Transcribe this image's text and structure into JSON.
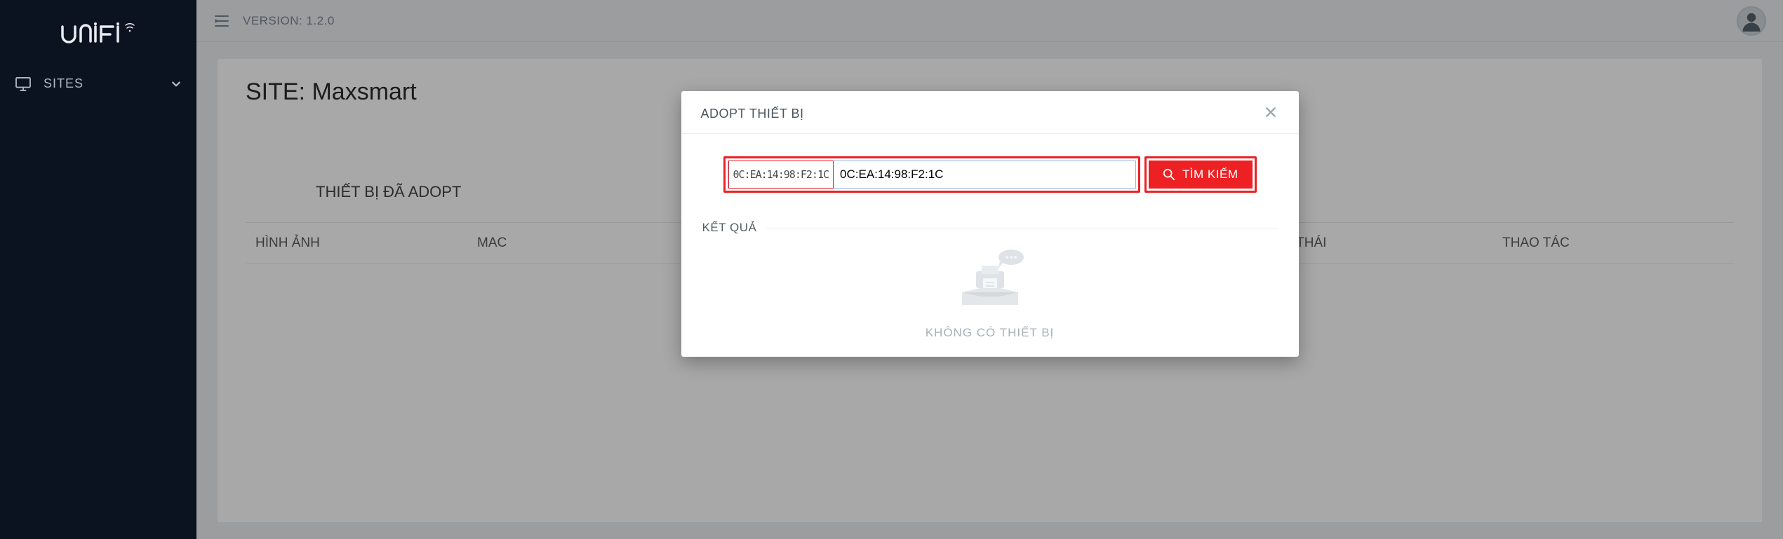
{
  "brand": {
    "name": "UniFi"
  },
  "sidebar": {
    "items": [
      {
        "label": "SITES",
        "icon": "monitor-icon"
      }
    ]
  },
  "topbar": {
    "version_label": "VERSION: 1.2.0"
  },
  "page": {
    "title": "SITE: Maxsmart",
    "section_title": "THIẾT BỊ ĐÃ ADOPT",
    "columns": {
      "image": "HÌNH ẢNH",
      "mac": "MAC",
      "status": "TRẠNG THÁI",
      "action": "THAO TÁC"
    }
  },
  "modal": {
    "title": "ADOPT THIẾT BỊ",
    "search_value": "0C:EA:14:98:F2:1C",
    "search_button": "TÌM KIẾM",
    "result_label": "KẾT QUẢ",
    "empty_text": "KHÔNG CÓ THIẾT BỊ"
  }
}
